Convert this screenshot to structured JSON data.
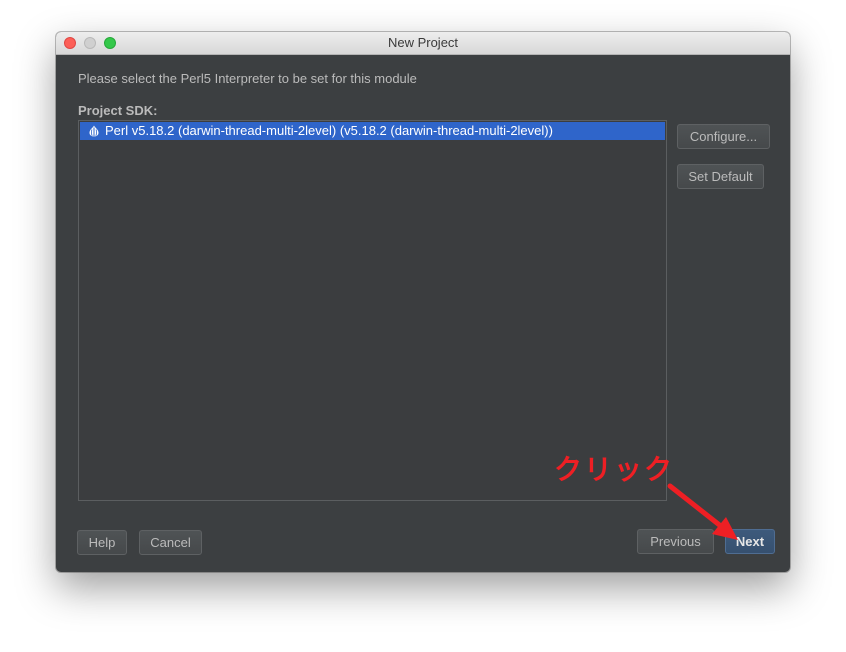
{
  "window": {
    "title": "New Project"
  },
  "dialog": {
    "instruction": "Please select the Perl5 Interpreter to be set for this module",
    "sdk_label": "Project SDK:",
    "sdk_items": [
      {
        "label": "Perl v5.18.2 (darwin-thread-multi-2level) (v5.18.2 (darwin-thread-multi-2level))",
        "icon": "perl-onion-icon",
        "selected": true
      }
    ],
    "side_buttons": {
      "configure": "Configure...",
      "set_default": "Set Default"
    },
    "footer": {
      "help": "Help",
      "cancel": "Cancel",
      "previous": "Previous",
      "next": "Next"
    }
  },
  "annotation": {
    "text": "クリック",
    "color": "#ee1f24"
  },
  "colors": {
    "background": "#3c3f41",
    "selection": "#2f65ca",
    "default_button": "#3d5a7c"
  }
}
